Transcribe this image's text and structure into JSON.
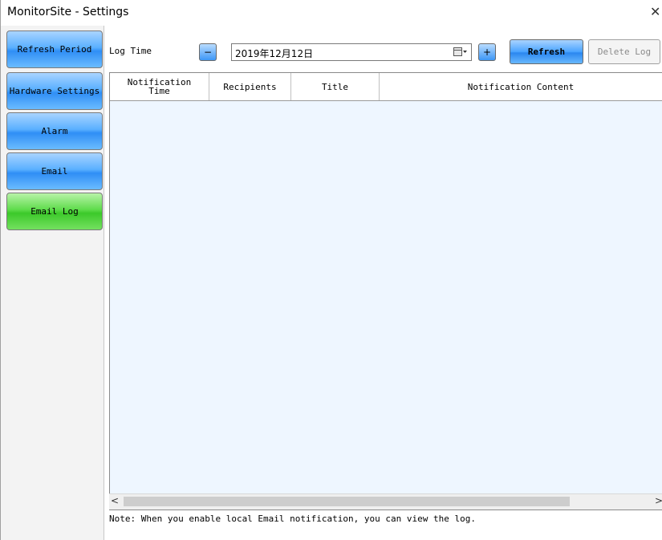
{
  "window": {
    "title": "MonitorSite - Settings",
    "close_glyph": "✕"
  },
  "sidebar": {
    "items": [
      {
        "label": "Refresh Period",
        "color": "#3d97f6"
      },
      {
        "label": "Hardware Settings",
        "color": "#3d97f6"
      },
      {
        "label": "Alarm",
        "color": "#3d97f6"
      },
      {
        "label": "Email",
        "color": "#3d97f6"
      },
      {
        "label": "Email Log",
        "color": "#3cc92a",
        "selected": true
      }
    ]
  },
  "toolbar": {
    "log_time_label": "Log Time",
    "decrement_label": "−",
    "date_value": "2019年12月12日",
    "calendar_icon": "calendar-dropdown-icon",
    "increment_label": "+",
    "refresh_label": "Refresh",
    "delete_log_label": "Delete Log"
  },
  "table": {
    "columns": [
      "Notification\nTime",
      "Recipients",
      "Title",
      "Notification Content"
    ],
    "rows": []
  },
  "scrollbar": {
    "left_arrow": "<",
    "right_arrow": ">"
  },
  "note": "Note: When you enable local Email notification, you can view the log."
}
